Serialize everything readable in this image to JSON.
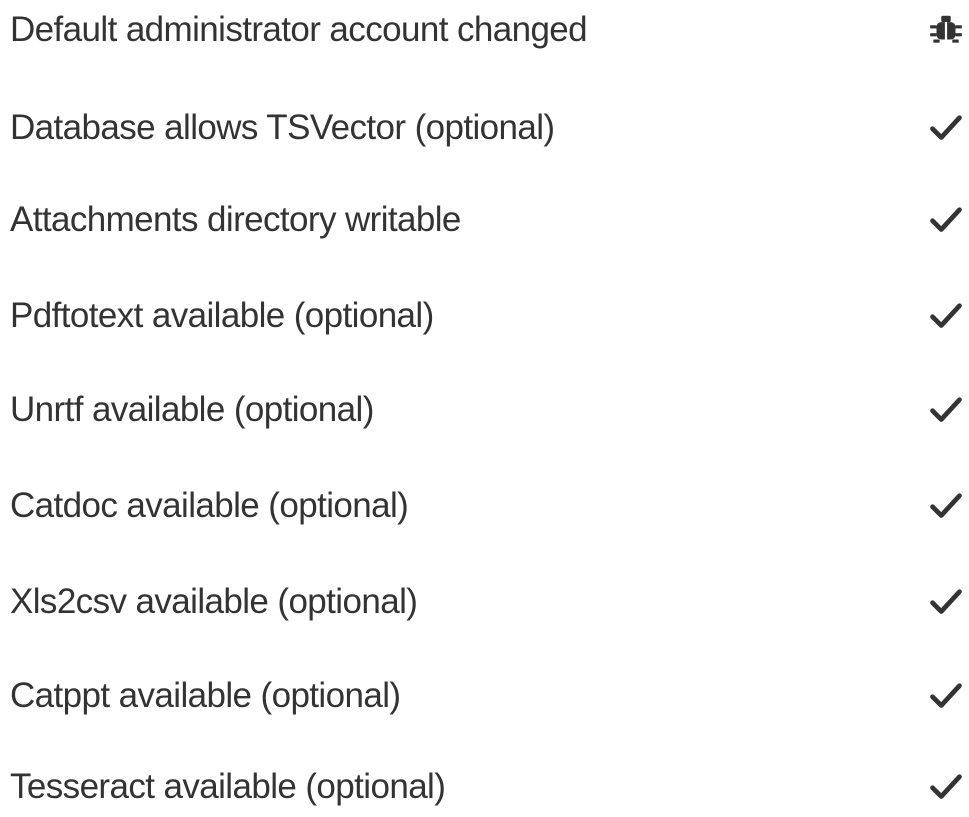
{
  "colors": {
    "text": "#333333",
    "icon": "#333333",
    "background": "#ffffff"
  },
  "checks": [
    {
      "label": "Default administrator account changed",
      "status_icon": "bug-icon"
    },
    {
      "label": "Database allows TSVector (optional)",
      "status_icon": "check-icon"
    },
    {
      "label": "Attachments directory writable",
      "status_icon": "check-icon"
    },
    {
      "label": "Pdftotext available (optional)",
      "status_icon": "check-icon"
    },
    {
      "label": "Unrtf available (optional)",
      "status_icon": "check-icon"
    },
    {
      "label": "Catdoc available (optional)",
      "status_icon": "check-icon"
    },
    {
      "label": "Xls2csv available (optional)",
      "status_icon": "check-icon"
    },
    {
      "label": "Catppt available (optional)",
      "status_icon": "check-icon"
    },
    {
      "label": "Tesseract available (optional)",
      "status_icon": "check-icon"
    }
  ]
}
